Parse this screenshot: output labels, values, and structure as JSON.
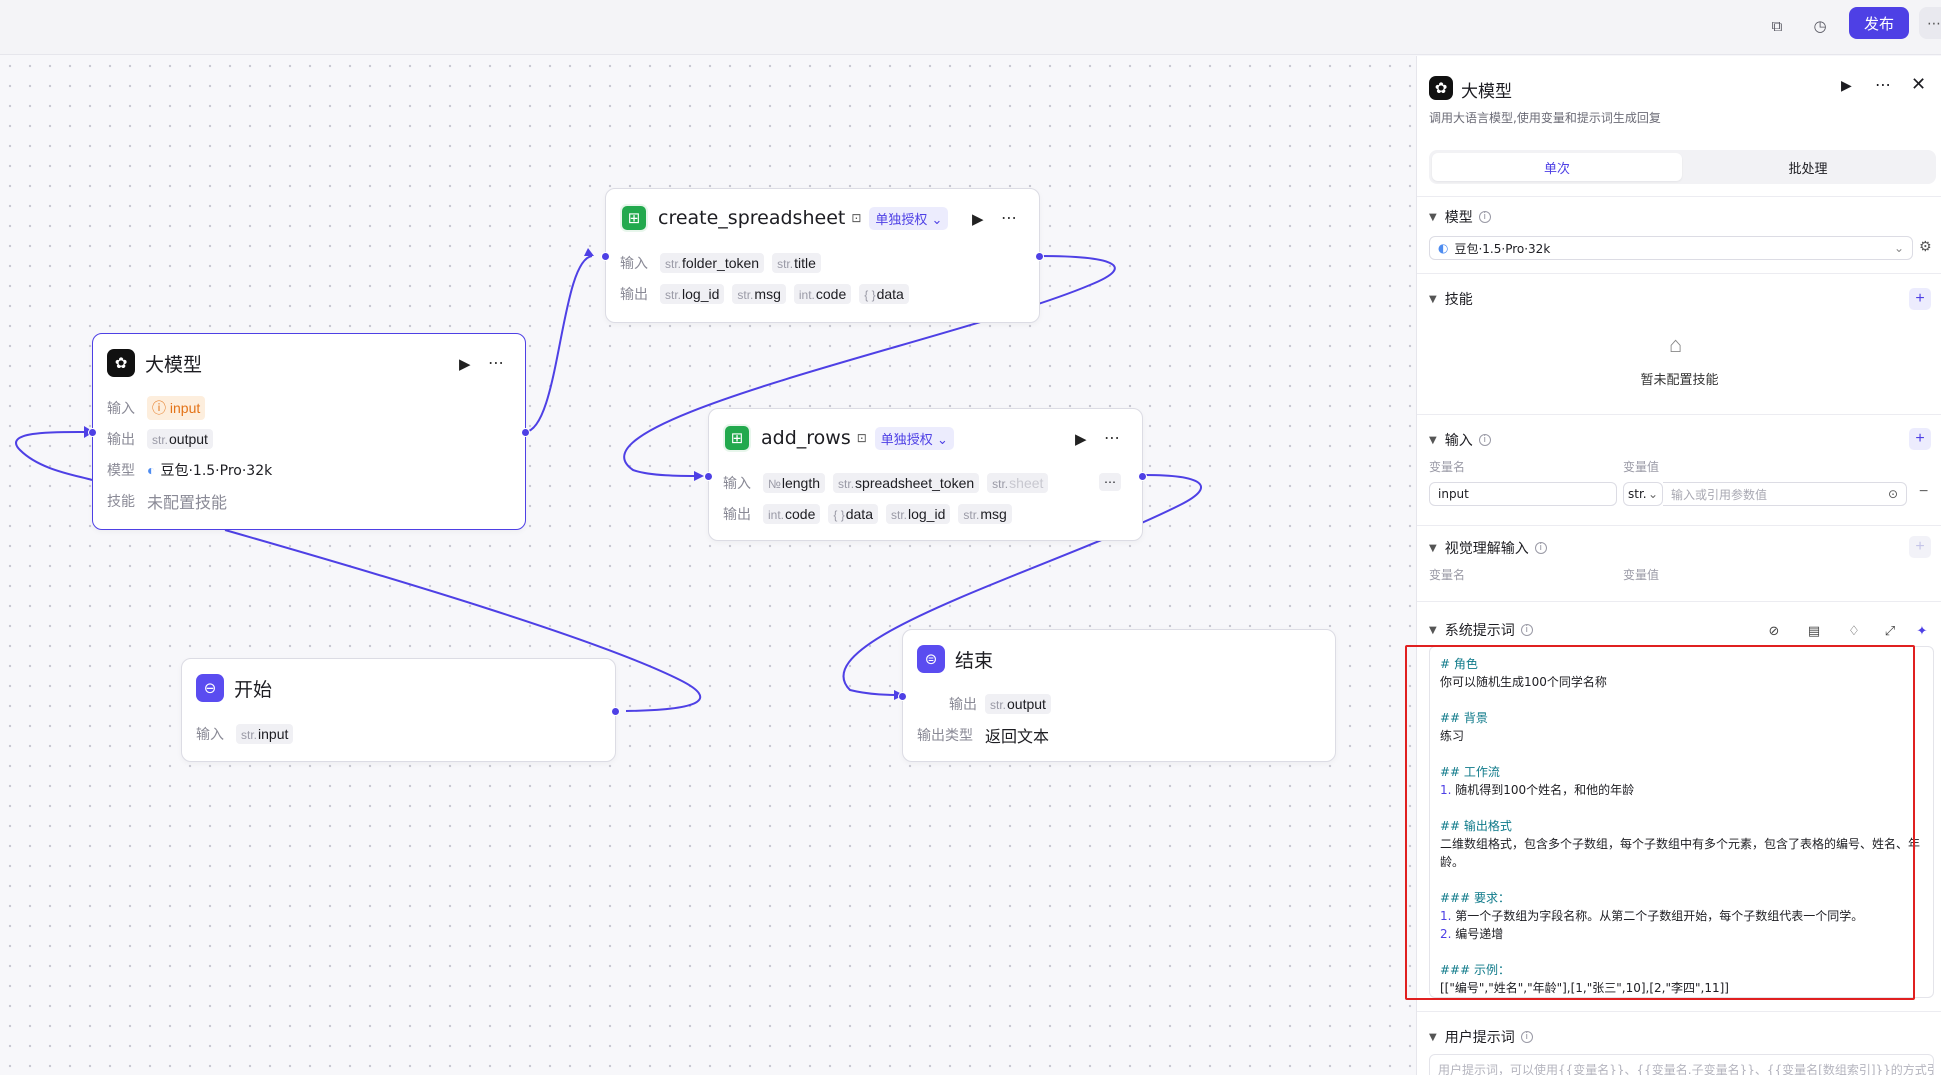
{
  "topbar": {
    "publish_label": "发布",
    "icons": [
      "copy-icon",
      "history-icon",
      "more-icon"
    ],
    "accent": "#4e40e5"
  },
  "nodes": {
    "llm": {
      "title": "大模型",
      "input_label": "输入",
      "input_tag": "input",
      "output_label": "输出",
      "output_type": "str.",
      "output_name": "output",
      "model_label": "模型",
      "model_value": "豆包·1.5·Pro·32k",
      "skill_label": "技能",
      "skill_value": "未配置技能"
    },
    "create_spreadsheet": {
      "title": "create_spreadsheet",
      "auth_badge": "单独授权",
      "input_label": "输入",
      "inputs": [
        {
          "type": "str.",
          "name": "folder_token"
        },
        {
          "type": "str.",
          "name": "title"
        }
      ],
      "output_label": "输出",
      "outputs": [
        {
          "type": "str.",
          "name": "log_id"
        },
        {
          "type": "str.",
          "name": "msg"
        },
        {
          "type": "int.",
          "name": "code"
        },
        {
          "type": "{ }",
          "name": "data"
        }
      ]
    },
    "add_rows": {
      "title": "add_rows",
      "auth_badge": "单独授权",
      "input_label": "输入",
      "inputs": [
        {
          "type": "№",
          "name": "length"
        },
        {
          "type": "str.",
          "name": "spreadsheet_token"
        },
        {
          "type": "str.",
          "name": "sheet"
        }
      ],
      "output_label": "输出",
      "outputs": [
        {
          "type": "int.",
          "name": "code"
        },
        {
          "type": "{ }",
          "name": "data"
        },
        {
          "type": "str.",
          "name": "log_id"
        },
        {
          "type": "str.",
          "name": "msg"
        }
      ]
    },
    "start": {
      "title": "开始",
      "input_label": "输入",
      "input_type": "str.",
      "input_name": "input"
    },
    "end": {
      "title": "结束",
      "output_label": "输出",
      "output_type": "str.",
      "output_name": "output",
      "output_type_label": "输出类型",
      "output_type_value": "返回文本"
    }
  },
  "panel": {
    "title": "大模型",
    "description": "调用大语言模型,使用变量和提示词生成回复",
    "tabs": [
      "单次",
      "批处理"
    ],
    "model_section": "模型",
    "model_value": "豆包·1.5·Pro·32k",
    "skill_section": "技能",
    "skill_empty": "暂未配置技能",
    "input_section": "输入",
    "var_name_label": "变量名",
    "var_value_label": "变量值",
    "input_var_name": "input",
    "input_var_type": "str.",
    "input_var_placeholder": "输入或引用参数值",
    "vision_section": "视觉理解输入",
    "vision_var_name_label": "变量名",
    "vision_var_value_label": "变量值",
    "system_prompt_section": "系统提示词",
    "system_prompt_lines": [
      {
        "kind": "h",
        "text": "# 角色"
      },
      {
        "kind": "t",
        "text": "你可以随机生成100个同学名称"
      },
      {
        "kind": "gap"
      },
      {
        "kind": "h",
        "text": "## 背景"
      },
      {
        "kind": "t",
        "text": "练习"
      },
      {
        "kind": "gap"
      },
      {
        "kind": "h",
        "text": "## 工作流"
      },
      {
        "kind": "n",
        "num": "1.",
        "text": " 随机得到100个姓名，和他的年龄"
      },
      {
        "kind": "gap"
      },
      {
        "kind": "h",
        "text": "## 输出格式"
      },
      {
        "kind": "w",
        "text": "二维数组格式，包含多个子数组，每个子数组中有多个元素，包含了表格的编号、姓名、年龄。"
      },
      {
        "kind": "gap"
      },
      {
        "kind": "h",
        "text": "### 要求："
      },
      {
        "kind": "n",
        "num": "1.",
        "text": " 第一个子数组为字段名称。从第二个子数组开始，每个子数组代表一个同学。"
      },
      {
        "kind": "n",
        "num": "2.",
        "text": " 编号递增"
      },
      {
        "kind": "gap"
      },
      {
        "kind": "h",
        "text": "### 示例："
      },
      {
        "kind": "t",
        "text": "[[\"编号\",\"姓名\",\"年龄\"],[1,\"张三\",10],[2,\"李四\",11]]"
      }
    ],
    "user_prompt_section": "用户提示词",
    "user_prompt_placeholder": "用户提示词，可以使用{{变量名}}、{{变量名.子变量名}}、{{变量名[数组索引]}}的方式引用输"
  }
}
